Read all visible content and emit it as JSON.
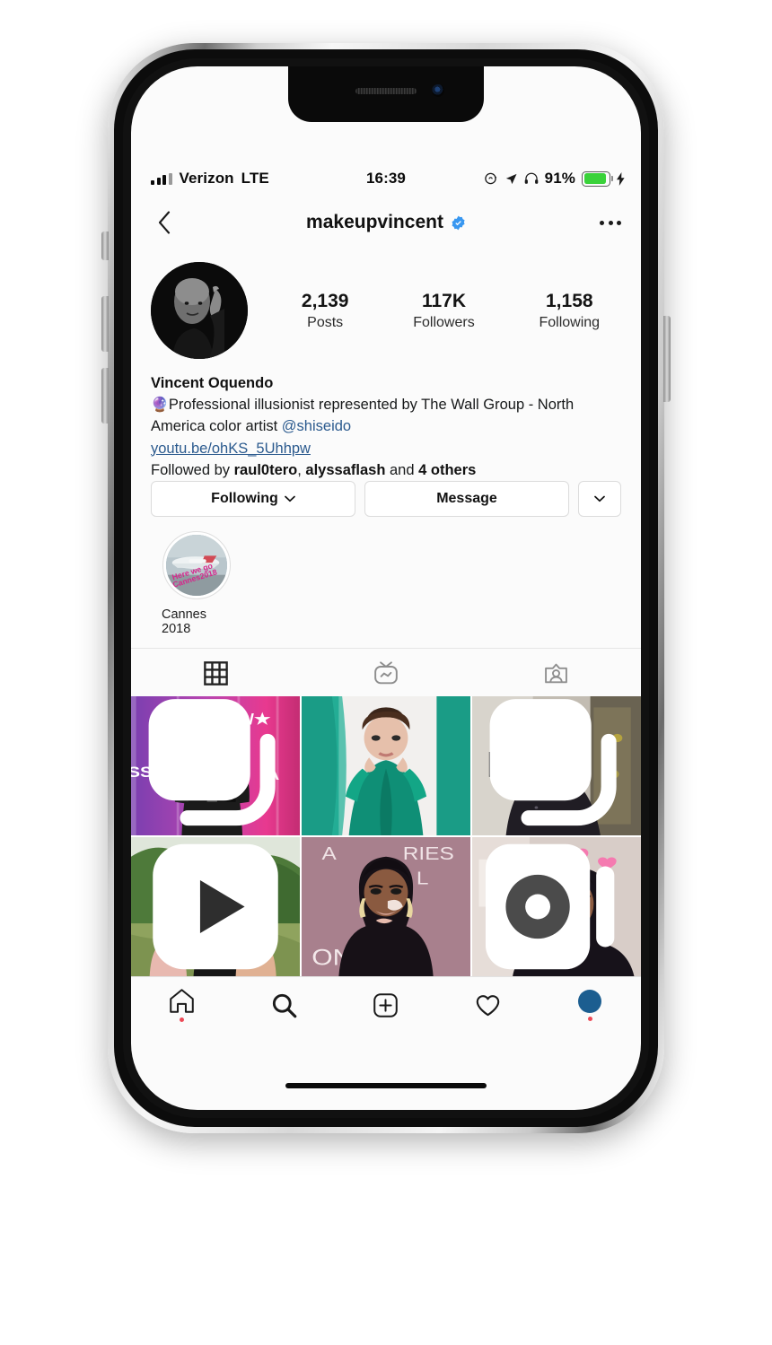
{
  "status_bar": {
    "carrier": "Verizon",
    "network": "LTE",
    "time": "16:39",
    "battery_percent": "91%",
    "icons": [
      "signal-bars-icon",
      "rotation-lock-icon",
      "location-arrow-icon",
      "headphones-icon",
      "battery-icon",
      "charging-bolt-icon"
    ]
  },
  "nav": {
    "back_icon": "back-chevron-icon",
    "username": "makeupvincent",
    "verified_icon": "verified-badge-icon",
    "more_icon": "more-options-icon"
  },
  "profile": {
    "avatar_alt": "profile-photo",
    "stats": [
      {
        "value": "2,139",
        "label": "Posts"
      },
      {
        "value": "117K",
        "label": "Followers"
      },
      {
        "value": "1,158",
        "label": "Following"
      }
    ],
    "full_name": "Vincent Oquendo",
    "bio_emoji": "🔮",
    "bio_text_1": "Professional illusionist represented by The Wall Group - North America color artist ",
    "bio_mention": "@shiseido",
    "website": "youtu.be/ohKS_5Uhhpw",
    "followed_by_prefix": "Followed by ",
    "followed_by_1": "raul0tero",
    "followed_by_sep": ", ",
    "followed_by_2": "alyssaflash",
    "followed_by_and": " and ",
    "followed_by_others": "4 others"
  },
  "actions": {
    "following_label": "Following",
    "message_label": "Message",
    "caret_icon": "chevron-down-icon"
  },
  "highlights": [
    {
      "label": "Cannes 2018",
      "overlay_line_1": "Here we go",
      "overlay_line_2": "#Cannes2018"
    }
  ],
  "tabs": [
    {
      "name": "grid-tab",
      "icon": "grid-icon",
      "active": true
    },
    {
      "name": "igtv-tab",
      "icon": "igtv-icon",
      "active": false
    },
    {
      "name": "tagged-tab",
      "icon": "tagged-person-icon",
      "active": false
    }
  ],
  "grid_posts": [
    {
      "name": "post-access-carpet",
      "badge": "carousel-icon",
      "text_1": "ACCESS/★",
      "text_2": "SS/★"
    },
    {
      "name": "post-green-satin-portrait",
      "badge": ""
    },
    {
      "name": "post-blonde-portrait",
      "badge": "carousel-icon"
    },
    {
      "name": "post-outdoor-video",
      "badge": "play-video-icon"
    },
    {
      "name": "post-carpet-portrait",
      "badge": "",
      "text_1": "A",
      "text_2": "RIES",
      "text_3": "L",
      "text_4": "ON"
    },
    {
      "name": "post-heart-filter-selfie",
      "badge": "reel-video-icon"
    }
  ],
  "tabbar": [
    {
      "name": "home-tab",
      "icon": "home-icon",
      "badge": true
    },
    {
      "name": "search-tab",
      "icon": "search-icon",
      "badge": false
    },
    {
      "name": "add-post-tab",
      "icon": "plus-square-icon",
      "badge": false
    },
    {
      "name": "activity-tab",
      "icon": "heart-icon",
      "badge": false
    },
    {
      "name": "profile-tab",
      "icon": "profile-avatar-icon",
      "badge": true
    }
  ],
  "colors": {
    "accent": "#3897f0",
    "link": "#2b5a8e",
    "badge_dot": "#ed4956",
    "battery": "#3ad23a"
  }
}
